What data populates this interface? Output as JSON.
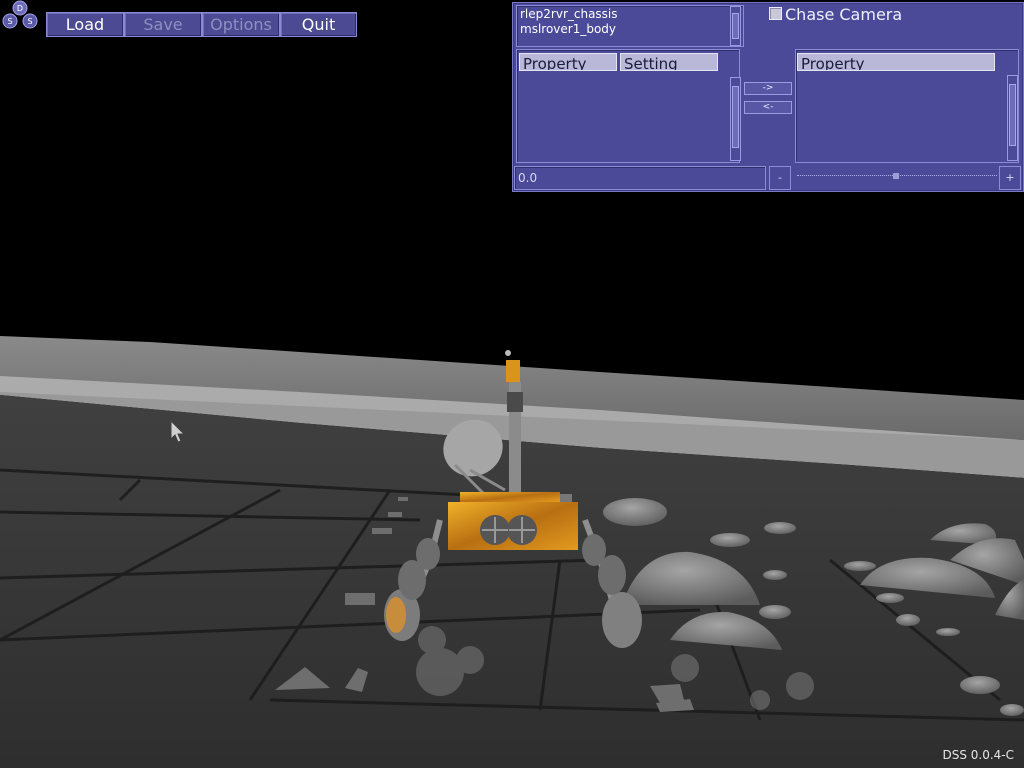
{
  "toolbar": {
    "load": "Load",
    "save": "Save",
    "options": "Options",
    "quit": "Quit"
  },
  "logo": {
    "top": "D",
    "left": "S",
    "right": "S"
  },
  "panel": {
    "objects": [
      "rlep2rvr_chassis",
      "mslrover1_body"
    ],
    "chase_camera_label": "Chase Camera",
    "chase_camera_checked": false,
    "left_table": {
      "headers": [
        "Property",
        "Setting"
      ]
    },
    "right_table": {
      "headers": [
        "Property"
      ]
    },
    "move_right": "->",
    "move_left": "<-",
    "value_field": "0.0",
    "minus": "-",
    "plus": "+"
  },
  "version": "DSS 0.0.4-C",
  "colors": {
    "panel_bg": "#4a4a98",
    "button_bg": "#4b4a93",
    "header_bg": "#b9b8d9",
    "rover_orange": "#e0a020"
  },
  "icons": [
    "logo-icon",
    "mouse-pointer-icon",
    "checkbox-icon"
  ]
}
